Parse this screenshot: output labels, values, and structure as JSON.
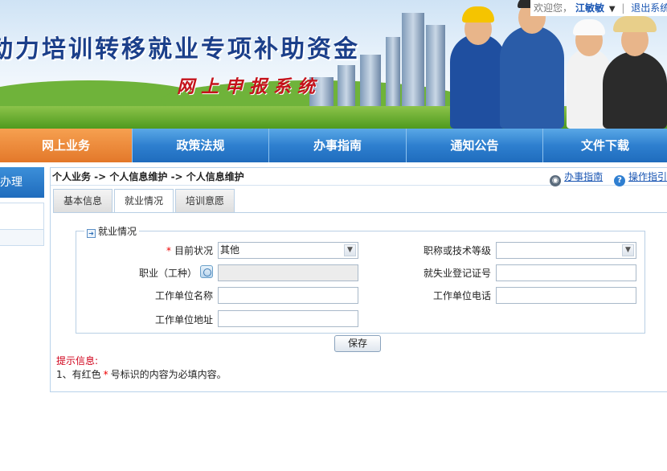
{
  "header": {
    "title": "动力培训转移就业专项补助资金",
    "subtitle": "网上申报系统"
  },
  "userbar": {
    "welcome": "欢迎您，",
    "username": "江敏敏",
    "logout": "退出系统"
  },
  "nav": {
    "items": [
      "网上业务",
      "政策法规",
      "办事指南",
      "通知公告",
      "文件下载"
    ],
    "active": "网上业务"
  },
  "sidebar": {
    "header": "业务办理"
  },
  "breadcrumb": {
    "items": [
      "个人业务",
      "个人信息维护",
      "个人信息维护"
    ],
    "text": "个人业务 -> 个人信息维护 -> 个人信息维护"
  },
  "toplinks": {
    "guide": "办事指南",
    "manual": "操作指引"
  },
  "tabs": {
    "items": [
      "基本信息",
      "就业情况",
      "培训意愿"
    ],
    "active": "就业情况"
  },
  "form": {
    "legend": "就业情况",
    "current_status_label": "目前状况",
    "current_status_value": "其他",
    "occupation_label": "职业（工种）",
    "occupation_value": "",
    "employer_name_label": "工作单位名称",
    "employer_name_value": "",
    "employer_address_label": "工作单位地址",
    "employer_address_value": "",
    "title_level_label": "职称或技术等级",
    "title_level_value": "",
    "registration_no_label": "就失业登记证号",
    "registration_no_value": "",
    "employer_phone_label": "工作单位电话",
    "employer_phone_value": "",
    "required_mark": "*",
    "save_label": "保存"
  },
  "hints": {
    "title": "提示信息:",
    "line_before": "1、有红色",
    "mark": "*",
    "line_after": "号标识的内容为必填内容。"
  },
  "colors": {
    "nav_blue": "#2e7fcf",
    "nav_active": "#e3782a",
    "title_blue": "#1b3f8a",
    "subtitle_red": "#c5121b",
    "required_red": "#e00000",
    "link_blue": "#1a56b3"
  }
}
